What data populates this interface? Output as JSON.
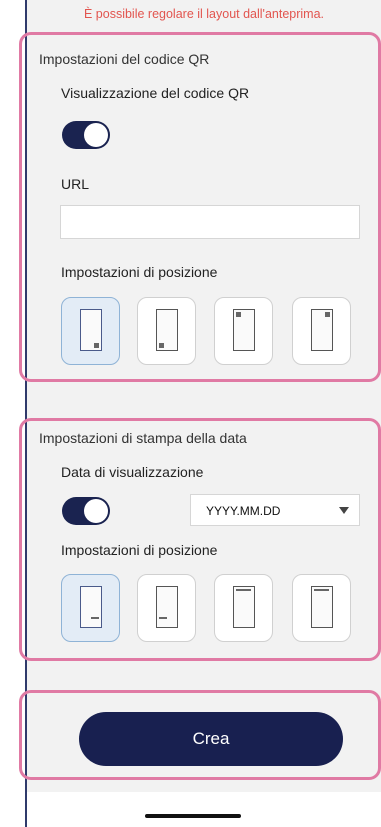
{
  "warning_text": "È possibile regolare il layout dall'anteprima.",
  "qr_settings": {
    "title": "Impostazioni del codice QR",
    "display_label": "Visualizzazione del codice QR",
    "display_enabled": true,
    "url_label": "URL",
    "url_value": "",
    "position_label": "Impostazioni di posizione",
    "positions": [
      "bottom-right",
      "bottom-left",
      "top-left",
      "top-right"
    ],
    "selected_position": "bottom-right"
  },
  "date_settings": {
    "title": "Impostazioni di stampa della data",
    "display_label": "Data di visualizzazione",
    "display_enabled": true,
    "format_value": "YYYY.MM.DD",
    "position_label": "Impostazioni di posizione",
    "positions": [
      "bottom-right",
      "bottom-left",
      "top-left",
      "top-right"
    ],
    "selected_position": "bottom-right"
  },
  "actions": {
    "create_label": "Crea"
  },
  "colors": {
    "accent": "#182050",
    "highlight_frame": "#e07aa4",
    "warning": "#e2554f",
    "selected_bg": "#e3ecf6"
  }
}
